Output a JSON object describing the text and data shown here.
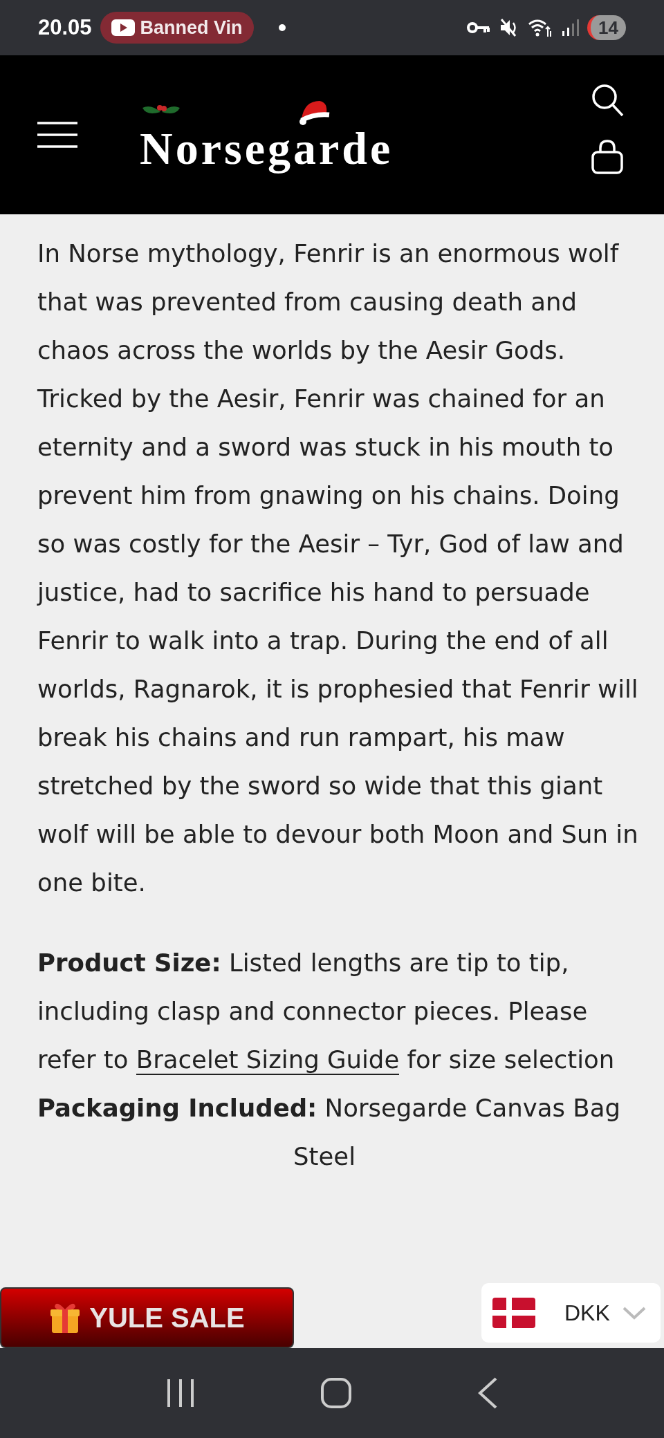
{
  "status_bar": {
    "time": "20.05",
    "notification": "Banned Vin",
    "battery": "14"
  },
  "header": {
    "logo": "Norsegarde"
  },
  "description": "In Norse mythology, Fenrir is an enormous wolf that was prevented from causing death and chaos across the worlds by the Aesir Gods. Tricked by the Aesir, Fenrir was chained for an eternity and a sword was stuck in his mouth to prevent him from gnawing on his chains. Doing so was costly for the Aesir – Tyr, God of law and justice, had to sacrifice his hand to persuade Fenrir to walk into a trap. During the end of all worlds, Ragnarok, it is prophesied that Fenrir will break his chains and run rampart, his maw stretched by the sword so wide that this giant wolf will be able to devour both Moon and Sun in one bite.",
  "details": [
    {
      "label": "Product Size:",
      "text": "Listed lengths are tip to tip, including clasp and connector pieces. Please refer to",
      "link": "Bracelet Sizing Guide",
      "text_after": "for size selection"
    },
    {
      "label": "Packaging Included:",
      "text": "Norsegarde Canvas Bag"
    }
  ],
  "partial_line": "Steel",
  "promo_button": {
    "label": "YULE SALE"
  },
  "currency": {
    "code": "DKK"
  }
}
